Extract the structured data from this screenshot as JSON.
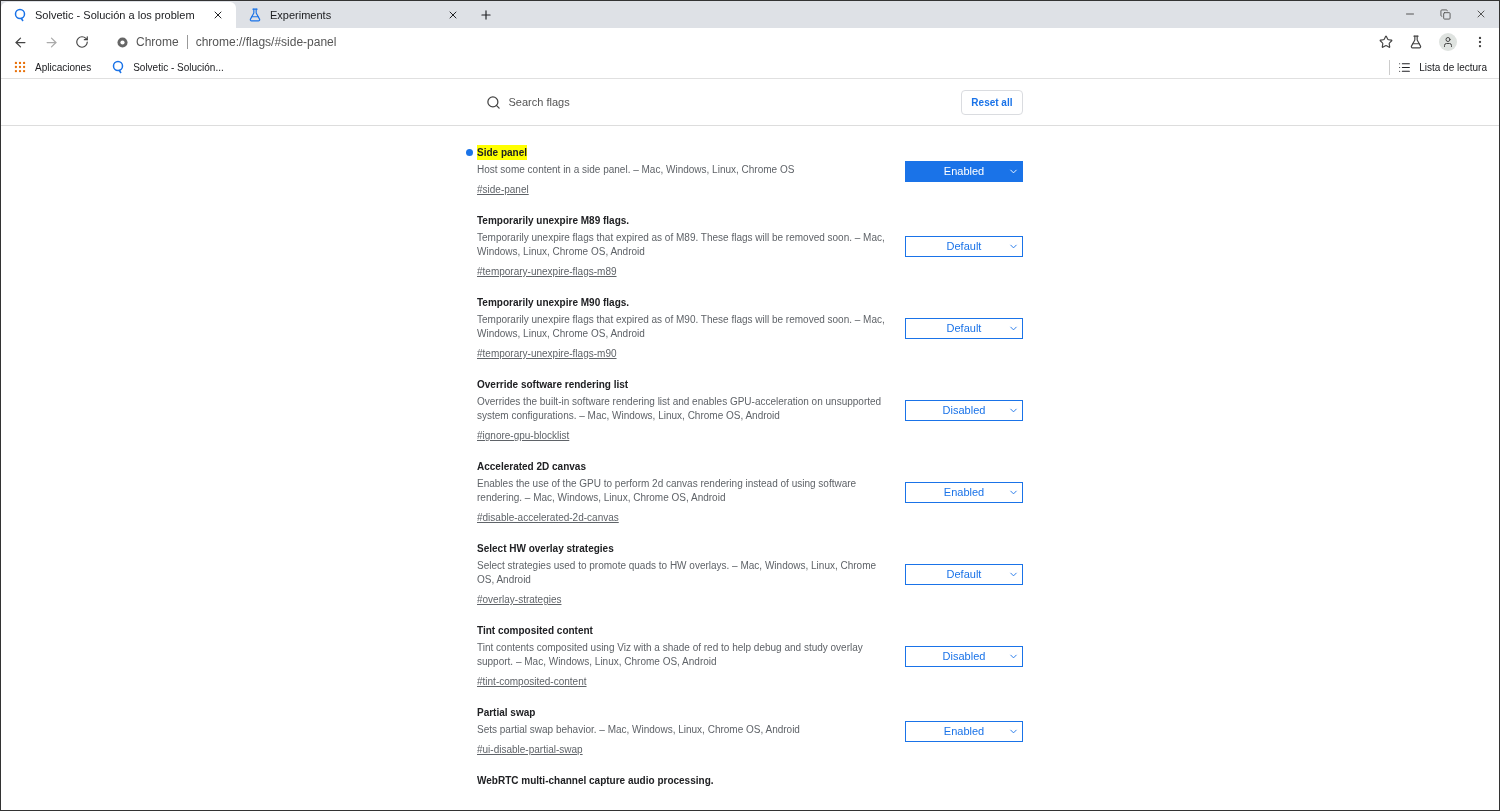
{
  "tabs": [
    {
      "title": "Solvetic - Solución a los problem",
      "selected": true
    },
    {
      "title": "Experiments",
      "selected": false
    }
  ],
  "address_bar": {
    "site_label": "Chrome",
    "url": "chrome://flags/#side-panel"
  },
  "bookmarks": [
    "Aplicaciones",
    "Solvetic - Solución..."
  ],
  "reading_list": "Lista de lectura",
  "search": {
    "placeholder": "Search flags"
  },
  "reset_button": "Reset all",
  "flags": [
    {
      "title": "Side panel",
      "description": "Host some content in a side panel. – Mac, Windows, Linux, Chrome OS",
      "link": "#side-panel",
      "value": "Enabled",
      "modified": true,
      "highlighted": true
    },
    {
      "title": "Temporarily unexpire M89 flags.",
      "description": "Temporarily unexpire flags that expired as of M89. These flags will be removed soon. – Mac, Windows, Linux, Chrome OS, Android",
      "link": "#temporary-unexpire-flags-m89",
      "value": "Default",
      "modified": false,
      "highlighted": false
    },
    {
      "title": "Temporarily unexpire M90 flags.",
      "description": "Temporarily unexpire flags that expired as of M90. These flags will be removed soon. – Mac, Windows, Linux, Chrome OS, Android",
      "link": "#temporary-unexpire-flags-m90",
      "value": "Default",
      "modified": false,
      "highlighted": false
    },
    {
      "title": "Override software rendering list",
      "description": "Overrides the built-in software rendering list and enables GPU-acceleration on unsupported system configurations. – Mac, Windows, Linux, Chrome OS, Android",
      "link": "#ignore-gpu-blocklist",
      "value": "Disabled",
      "modified": false,
      "highlighted": false
    },
    {
      "title": "Accelerated 2D canvas",
      "description": "Enables the use of the GPU to perform 2d canvas rendering instead of using software rendering. – Mac, Windows, Linux, Chrome OS, Android",
      "link": "#disable-accelerated-2d-canvas",
      "value": "Enabled",
      "modified": false,
      "highlighted": false
    },
    {
      "title": "Select HW overlay strategies",
      "description": "Select strategies used to promote quads to HW overlays. – Mac, Windows, Linux, Chrome OS, Android",
      "link": "#overlay-strategies",
      "value": "Default",
      "modified": false,
      "highlighted": false
    },
    {
      "title": "Tint composited content",
      "description": "Tint contents composited using Viz with a shade of red to help debug and study overlay support. – Mac, Windows, Linux, Chrome OS, Android",
      "link": "#tint-composited-content",
      "value": "Disabled",
      "modified": false,
      "highlighted": false
    },
    {
      "title": "Partial swap",
      "description": "Sets partial swap behavior. – Mac, Windows, Linux, Chrome OS, Android",
      "link": "#ui-disable-partial-swap",
      "value": "Enabled",
      "modified": false,
      "highlighted": false
    },
    {
      "title": "WebRTC multi-channel capture audio processing."
    }
  ]
}
